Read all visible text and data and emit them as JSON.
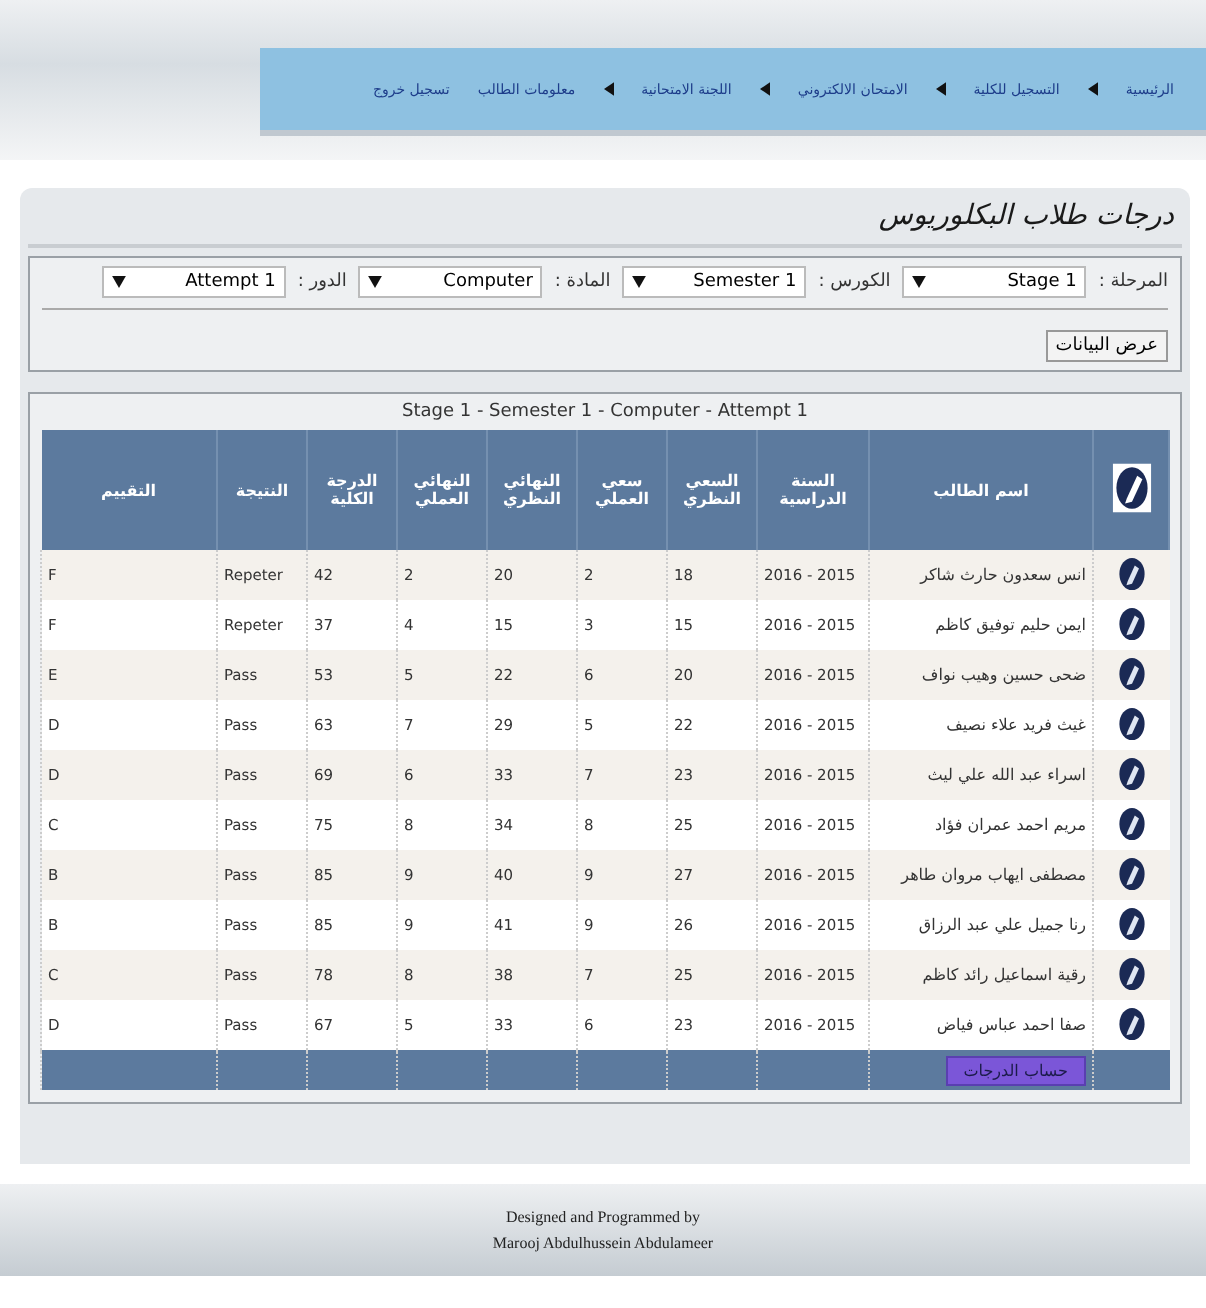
{
  "nav": {
    "items": [
      {
        "label": "الرئيسية",
        "arrow": true
      },
      {
        "label": "التسجيل للكلية",
        "arrow": true
      },
      {
        "label": "الامتحان الالكتروني",
        "arrow": true
      },
      {
        "label": "اللجنة الامتحانية",
        "arrow": true
      },
      {
        "label": "معلومات الطالب",
        "arrow": false
      },
      {
        "label": "تسجيل خروج",
        "arrow": false
      }
    ]
  },
  "page_title": "درجات طلاب البكلوريوس",
  "filters": [
    {
      "label": "المرحلة :",
      "value": "Stage 1"
    },
    {
      "label": "الكورس :",
      "value": "Semester 1"
    },
    {
      "label": "المادة :",
      "value": "Computer"
    },
    {
      "label": "الدور :",
      "value": "Attempt 1"
    }
  ],
  "show_button": "عرض البيانات",
  "table": {
    "caption": "Stage 1 - Semester 1 - Computer - Attempt 1",
    "columns": [
      "اسم الطالب",
      "السنة الدراسية",
      "السعي النظري",
      "سعي العملي",
      "النهائي النظري",
      "النهائي العملي",
      "الدرجة الكلية",
      "النتيجة",
      "التقييم"
    ],
    "rows": [
      [
        "انس سعدون حارث شاكر",
        "2016 - 2015",
        "18",
        "2",
        "20",
        "2",
        "42",
        "Repeter",
        "F"
      ],
      [
        "ايمن حليم توفيق كاظم",
        "2016 - 2015",
        "15",
        "3",
        "15",
        "4",
        "37",
        "Repeter",
        "F"
      ],
      [
        "ضحى حسين وهيب نواف",
        "2016 - 2015",
        "20",
        "6",
        "22",
        "5",
        "53",
        "Pass",
        "E"
      ],
      [
        "غيث فريد علاء نصيف",
        "2016 - 2015",
        "22",
        "5",
        "29",
        "7",
        "63",
        "Pass",
        "D"
      ],
      [
        "اسراء عبد الله علي ليث",
        "2016 - 2015",
        "23",
        "7",
        "33",
        "6",
        "69",
        "Pass",
        "D"
      ],
      [
        "مريم احمد عمران فؤاد",
        "2016 - 2015",
        "25",
        "8",
        "34",
        "8",
        "75",
        "Pass",
        "C"
      ],
      [
        "مصطفى ايهاب مروان طاهر",
        "2016 - 2015",
        "27",
        "9",
        "40",
        "9",
        "85",
        "Pass",
        "B"
      ],
      [
        "رنا جميل علي عبد الرزاق",
        "2016 - 2015",
        "26",
        "9",
        "41",
        "9",
        "85",
        "Pass",
        "B"
      ],
      [
        "رقية اسماعيل رائد كاظم",
        "2016 - 2015",
        "25",
        "7",
        "38",
        "8",
        "78",
        "Pass",
        "C"
      ],
      [
        "صفا احمد عباس فياض",
        "2016 - 2015",
        "23",
        "6",
        "33",
        "5",
        "67",
        "Pass",
        "D"
      ]
    ],
    "calc_button": "حساب الدرجات"
  },
  "footer": [
    "Designed and Programmed by",
    "Marooj Abdulhussein Abdulameer"
  ]
}
